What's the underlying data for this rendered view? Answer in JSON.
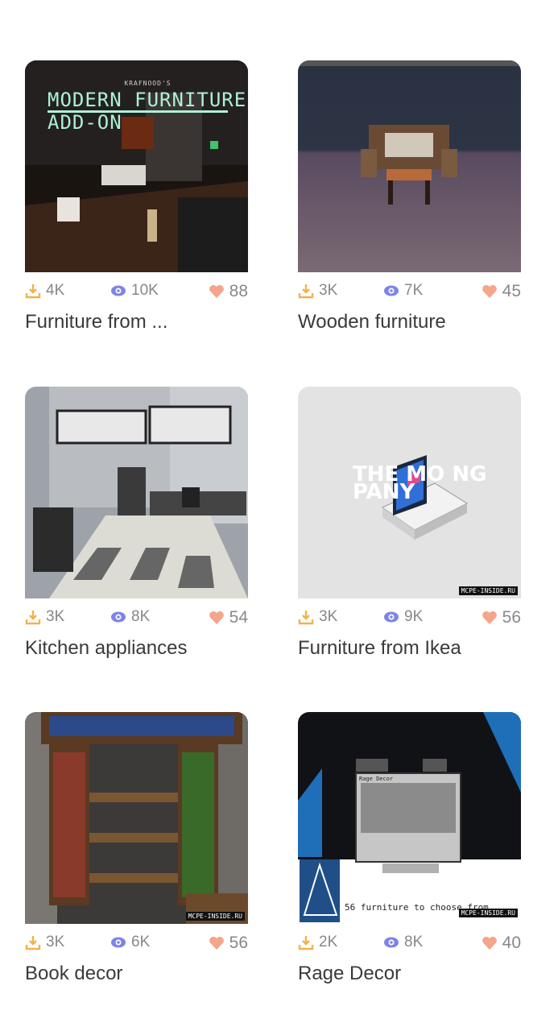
{
  "items": [
    {
      "title": "Furniture from ...",
      "downloads": "4K",
      "views": "10K",
      "likes": "88",
      "thumb": {
        "heading": "MODERN FURNITURE ADD-ON",
        "subheading": "KRAFNOOD'S"
      }
    },
    {
      "title": "Wooden furniture",
      "downloads": "3K",
      "views": "7K",
      "likes": "45"
    },
    {
      "title": "Kitchen appliances",
      "downloads": "3K",
      "views": "8K",
      "likes": "54"
    },
    {
      "title": "Furniture from Ikea",
      "downloads": "3K",
      "views": "9K",
      "likes": "56",
      "thumb": {
        "brand": "THE MO NG PANY",
        "watermark": "MCPE-INSIDE.RU"
      }
    },
    {
      "title": "Book decor",
      "downloads": "3K",
      "views": "6K",
      "likes": "56",
      "thumb": {
        "watermark": "MCPE-INSIDE.RU"
      }
    },
    {
      "title": "Rage Decor",
      "downloads": "2K",
      "views": "8K",
      "likes": "40",
      "thumb": {
        "caption": "56 furniture to choose from...",
        "panel_title": "Rage Decor",
        "watermark": "MCPE-INSIDE.RU"
      }
    }
  ],
  "colors": {
    "download": "#f2b24a",
    "view": "#7c85e6",
    "like": "#f4a58a",
    "title": "#3a3a3a",
    "stat": "#888888"
  },
  "icons": {
    "download": "download-icon",
    "view": "eye-icon",
    "like": "heart-icon"
  }
}
